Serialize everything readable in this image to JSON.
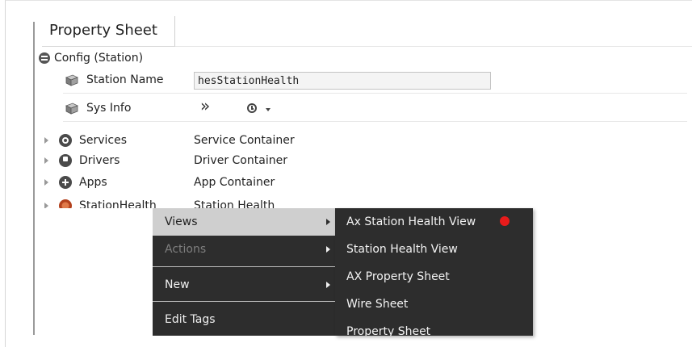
{
  "tab": {
    "label": "Property Sheet"
  },
  "config": {
    "label": "Config  (Station)"
  },
  "properties": {
    "station_name": {
      "label": "Station Name",
      "value": "hesStationHealth"
    },
    "sys_info": {
      "label": "Sys Info",
      "action_icon": "double-chevron-right-icon",
      "history_icon": "clock-icon"
    }
  },
  "tree": [
    {
      "name": "Services",
      "desc": "Service Container",
      "icon": "services-icon"
    },
    {
      "name": "Drivers",
      "desc": "Driver Container",
      "icon": "drivers-icon"
    },
    {
      "name": "Apps",
      "desc": "App Container",
      "icon": "apps-icon"
    },
    {
      "name": "StationHealth",
      "desc": "Station Health",
      "icon": "station-health-icon"
    }
  ],
  "context_menu": {
    "items": [
      {
        "label": "Views",
        "state": "highlighted",
        "has_submenu": true
      },
      {
        "label": "Actions",
        "state": "disabled",
        "has_submenu": true
      },
      {
        "label": "New",
        "state": "normal",
        "has_submenu": true
      },
      {
        "label": "Edit Tags",
        "state": "normal",
        "has_submenu": false
      }
    ]
  },
  "views_submenu": {
    "items": [
      {
        "label": "Ax Station Health View",
        "default_marker_color": "#e81b1b"
      },
      {
        "label": "Station Health View"
      },
      {
        "label": "AX Property Sheet"
      },
      {
        "label": "Wire Sheet"
      },
      {
        "label": "Property Sheet"
      }
    ]
  },
  "colors": {
    "menu_bg": "#2d2d2d",
    "menu_highlight": "#cfcfcf",
    "default_marker": "#e81b1b"
  }
}
